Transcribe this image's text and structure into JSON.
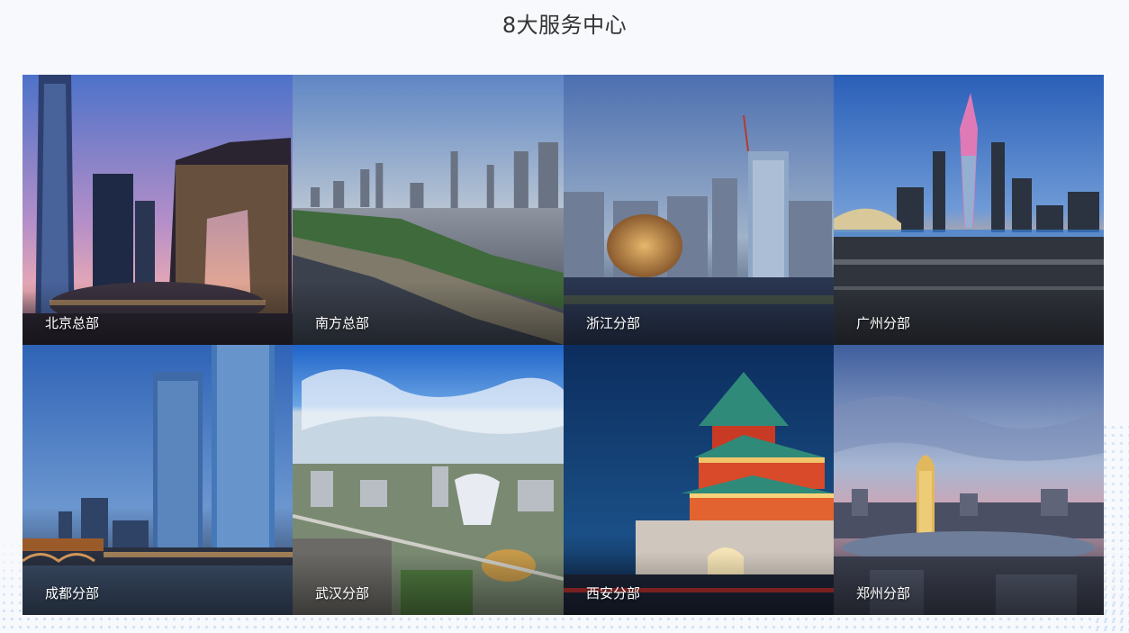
{
  "section": {
    "title": "8大服务中心"
  },
  "centers": [
    {
      "label": "北京总部",
      "icon": "beijing-skyline-photo"
    },
    {
      "label": "南方总部",
      "icon": "riverside-city-photo"
    },
    {
      "label": "浙江分部",
      "icon": "hangzhou-sun-building-photo"
    },
    {
      "label": "广州分部",
      "icon": "canton-tower-night-photo"
    },
    {
      "label": "成都分部",
      "icon": "chengdu-towers-bridge-photo"
    },
    {
      "label": "武汉分部",
      "icon": "wuhan-aerial-photo"
    },
    {
      "label": "西安分部",
      "icon": "xian-bell-tower-photo"
    },
    {
      "label": "郑州分部",
      "icon": "zhengzhou-corn-tower-photo"
    }
  ]
}
